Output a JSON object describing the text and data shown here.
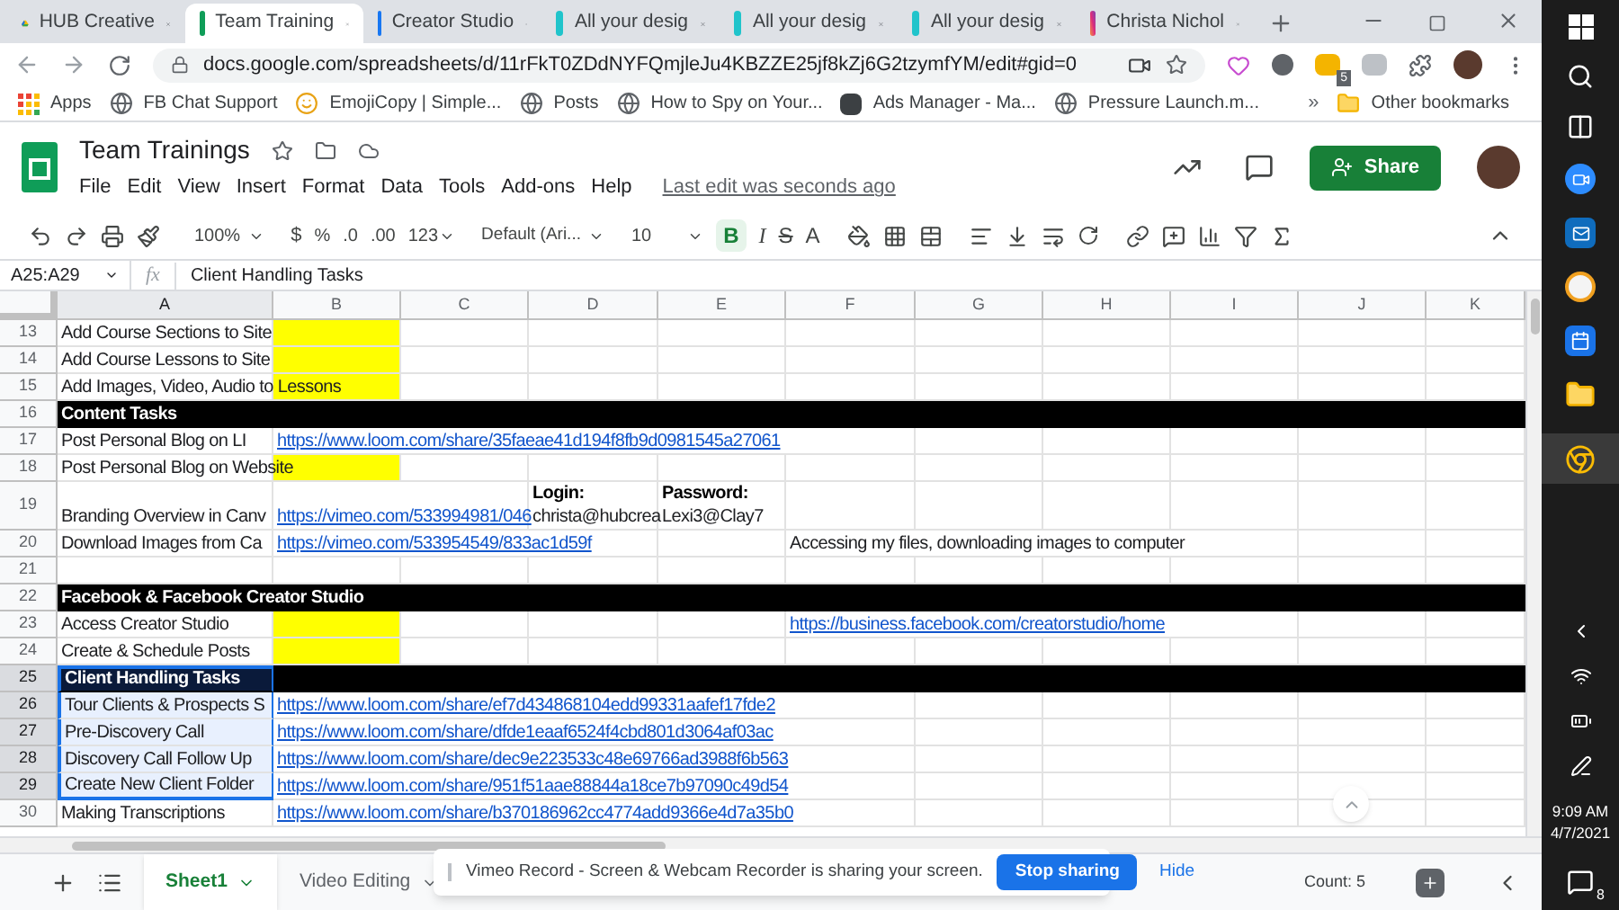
{
  "browser_tabs": [
    {
      "title": "HUB Creative",
      "kind": "drive",
      "selected": false
    },
    {
      "title": "Team Training",
      "kind": "sheets",
      "selected": true
    },
    {
      "title": "Creator Studio",
      "kind": "studio",
      "selected": false
    },
    {
      "title": "All your desig",
      "kind": "canva",
      "selected": false
    },
    {
      "title": "All your desig",
      "kind": "canva",
      "selected": false
    },
    {
      "title": "All your desig",
      "kind": "canva",
      "selected": false
    },
    {
      "title": "Christa Nichol",
      "kind": "instagram",
      "selected": false
    }
  ],
  "address_bar": {
    "url": "docs.google.com/spreadsheets/d/11rFkT0ZDdNYFQmjleJu4KBZZE25jf8kZj6G2tzymfYM/edit#gid=0"
  },
  "extension_badge": "5",
  "bookmarks": [
    {
      "label": "Apps",
      "kind": "apps"
    },
    {
      "label": "FB Chat Support",
      "kind": "globe"
    },
    {
      "label": "EmojiCopy | Simple...",
      "kind": "emoji"
    },
    {
      "label": "Posts",
      "kind": "globe"
    },
    {
      "label": "How to Spy on Your...",
      "kind": "globe"
    },
    {
      "label": "Ads Manager - Ma...",
      "kind": "ads"
    },
    {
      "label": "Pressure Launch.m...",
      "kind": "globe"
    }
  ],
  "bookmarks_more": "»",
  "other_bookmarks": "Other bookmarks",
  "document": {
    "title": "Team Trainings",
    "menus": [
      "File",
      "Edit",
      "View",
      "Insert",
      "Format",
      "Data",
      "Tools",
      "Add-ons",
      "Help"
    ],
    "last_edit": "Last edit was seconds ago",
    "share": "Share"
  },
  "toolbar": {
    "zoom": "100%",
    "currency": "$",
    "percent": "%",
    "decrease_decimals": ".0",
    "increase_decimals": ".00",
    "more_formats": "123",
    "font": "Default (Ari...",
    "font_size": "10",
    "bold": {
      "label": "B",
      "on": true
    },
    "italic": "I",
    "strikethrough": "S",
    "text_color": "A"
  },
  "formula_bar": {
    "range": "A25:A29",
    "fx": "fx",
    "value": "Client Handling Tasks"
  },
  "columns": [
    {
      "label": "A",
      "selected": true
    },
    {
      "label": "B",
      "selected": false
    },
    {
      "label": "C",
      "selected": false
    },
    {
      "label": "D",
      "selected": false
    },
    {
      "label": "E",
      "selected": false
    },
    {
      "label": "F",
      "selected": false
    },
    {
      "label": "G",
      "selected": false
    },
    {
      "label": "H",
      "selected": false
    },
    {
      "label": "I",
      "selected": false
    },
    {
      "label": "J",
      "selected": false
    },
    {
      "label": "K",
      "selected": false
    }
  ],
  "rows": [
    {
      "number": "13",
      "kind": "task",
      "tall": false,
      "selected": false,
      "highlight": true,
      "a": {
        "text": "Add Course Sections to Site"
      }
    },
    {
      "number": "14",
      "kind": "task",
      "tall": false,
      "selected": false,
      "highlight": true,
      "a": {
        "text": "Add Course Lessons to Site"
      }
    },
    {
      "number": "15",
      "kind": "task",
      "tall": false,
      "selected": false,
      "highlight": true,
      "a": {
        "text": "Add Images, Video, Audio to Lessons"
      }
    },
    {
      "number": "16",
      "kind": "section",
      "tall": false,
      "selected": false,
      "highlight": false,
      "a": {
        "text": "Content Tasks"
      }
    },
    {
      "number": "17",
      "kind": "task",
      "tall": false,
      "selected": false,
      "highlight": false,
      "a": {
        "text": "Post Personal Blog on LI"
      },
      "b": {
        "kind": "link",
        "text": "https://www.loom.com/share/35faeae41d194f8fb9d0981545a27061"
      }
    },
    {
      "number": "18",
      "kind": "task",
      "tall": false,
      "selected": false,
      "highlight": true,
      "a": {
        "text": "Post Personal Blog on Website"
      }
    },
    {
      "number": "19",
      "kind": "task",
      "tall": true,
      "selected": false,
      "highlight": false,
      "a": {
        "text": "Branding Overview in Canv"
      },
      "b": {
        "kind": "link",
        "text": "https://vimeo.com/533994981/046"
      },
      "d": {
        "kind": "labeled",
        "label": "Login:",
        "text": "christa@hubcrea"
      },
      "e": {
        "kind": "labeled",
        "label": "Password:",
        "text": "Lexi3@Clay7"
      }
    },
    {
      "number": "20",
      "kind": "task",
      "tall": false,
      "selected": false,
      "highlight": false,
      "a": {
        "text": "Download Images from Ca"
      },
      "b": {
        "kind": "link",
        "text": "https://vimeo.com/533954549/833ac1d59f"
      },
      "f": {
        "kind": "text",
        "text": "Accessing my files, downloading images to computer"
      }
    },
    {
      "number": "21",
      "kind": "task",
      "tall": false,
      "selected": false,
      "highlight": false
    },
    {
      "number": "22",
      "kind": "section",
      "tall": false,
      "selected": false,
      "highlight": false,
      "a": {
        "text": "Facebook & Facebook Creator Studio"
      }
    },
    {
      "number": "23",
      "kind": "task",
      "tall": false,
      "selected": false,
      "highlight": true,
      "a": {
        "text": "Access Creator Studio"
      },
      "f": {
        "kind": "link",
        "text": "https://business.facebook.com/creatorstudio/home"
      }
    },
    {
      "number": "24",
      "kind": "task",
      "tall": false,
      "selected": false,
      "highlight": true,
      "a": {
        "text": "Create & Schedule Posts"
      }
    },
    {
      "number": "25",
      "kind": "section",
      "tall": false,
      "selected": true,
      "highlight": false,
      "a": {
        "text": "Client Handling Tasks"
      }
    },
    {
      "number": "26",
      "kind": "task",
      "tall": false,
      "selected": true,
      "highlight": false,
      "a": {
        "text": "Tour Clients & Prospects S"
      },
      "b": {
        "kind": "link",
        "text": "https://www.loom.com/share/ef7d434868104edd99331aafef17fde2"
      }
    },
    {
      "number": "27",
      "kind": "task",
      "tall": false,
      "selected": true,
      "highlight": false,
      "a": {
        "text": "Pre-Discovery Call"
      },
      "b": {
        "kind": "link",
        "text": "https://www.loom.com/share/dfde1eaaf6524f4cbd801d3064af03ac"
      }
    },
    {
      "number": "28",
      "kind": "task",
      "tall": false,
      "selected": true,
      "highlight": false,
      "a": {
        "text": "Discovery Call Follow Up"
      },
      "b": {
        "kind": "link",
        "text": "https://www.loom.com/share/dec9e223533c48e69766ad3988f6b563"
      }
    },
    {
      "number": "29",
      "kind": "task",
      "tall": false,
      "selected": true,
      "highlight": false,
      "a": {
        "text": "Create New Client Folder"
      },
      "b": {
        "kind": "link",
        "text": "https://www.loom.com/share/951f51aae88844a18ce7b97090c49d54"
      }
    },
    {
      "number": "30",
      "kind": "task",
      "tall": false,
      "selected": false,
      "highlight": false,
      "a": {
        "text": "Making Transcriptions"
      },
      "b": {
        "kind": "link",
        "text": "https://www.loom.com/share/b370186962cc4774add9366e4d7a35b0"
      }
    }
  ],
  "sheet_tabs": [
    {
      "label": "Sheet1",
      "selected": true
    },
    {
      "label": "Video Editing",
      "selected": false
    }
  ],
  "sharing_notice": {
    "message": "Vimeo Record - Screen & Webcam Recorder is sharing your screen.",
    "stop": "Stop sharing",
    "hide": "Hide"
  },
  "selection_count": "Count: 5",
  "taskbar": {
    "time": "9:09 AM",
    "date": "4/7/2021",
    "notifications": "8"
  }
}
